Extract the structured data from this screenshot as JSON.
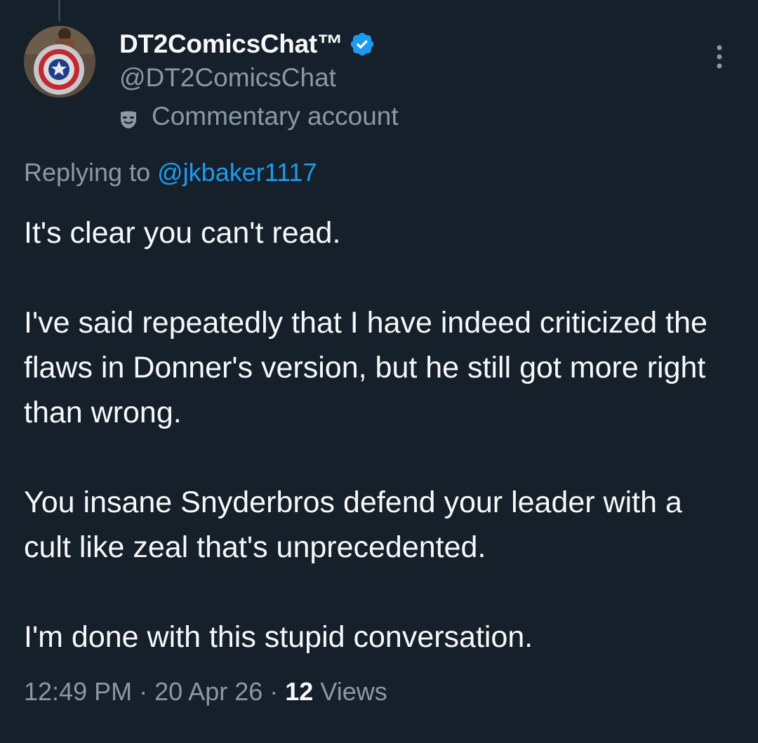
{
  "post": {
    "author": {
      "display_name": "DT2ComicsChat™",
      "handle": "@DT2ComicsChat",
      "label": "Commentary account",
      "label_icon": "mask-icon",
      "verified_icon": "verified-badge-icon"
    },
    "more_icon": "more-options-icon",
    "reply": {
      "prefix": "Replying to",
      "mention": "@jkbaker1117"
    },
    "paragraphs": [
      "It's clear you can't read.",
      "I've said repeatedly that I have indeed criticized the flaws in Donner's version, but he still got more right than wrong.",
      "You insane Snyderbros defend your leader with a cult like zeal that's unprecedented.",
      "I'm done with this stupid conversation."
    ],
    "meta": {
      "time": "12:49 PM",
      "date": "20 Apr 26",
      "separator": "·",
      "views_count": "12",
      "views_label": "Views"
    }
  },
  "colors": {
    "background": "#15202b",
    "primary_text": "#f7f9f9",
    "secondary_text": "#8b98a5",
    "accent": "#1d9bf0"
  }
}
